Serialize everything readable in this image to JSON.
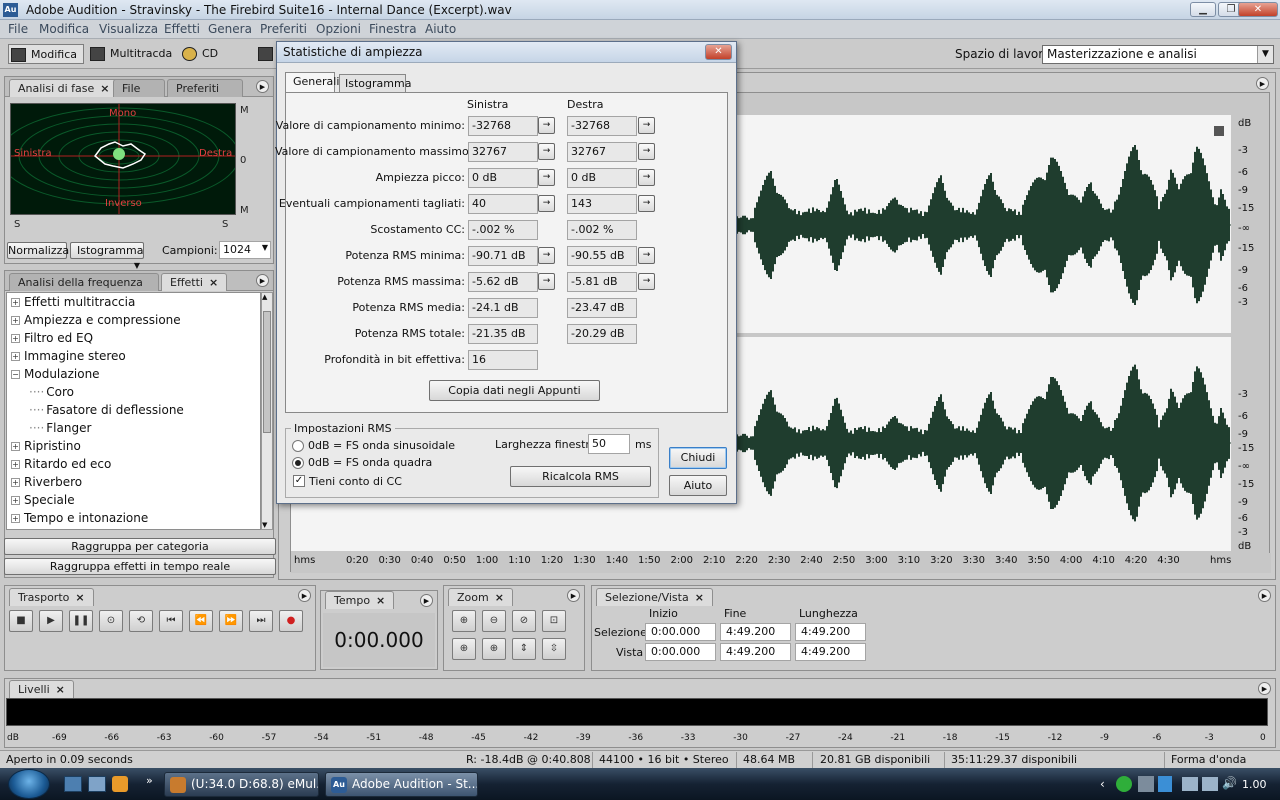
{
  "window": {
    "title": "Adobe Audition - Stravinsky - The Firebird Suite16 - Internal Dance (Excerpt).wav",
    "app_icon": "Au"
  },
  "menu": [
    "File",
    "Modifica",
    "Visualizza",
    "Effetti",
    "Genera",
    "Preferiti",
    "Opzioni",
    "Finestra",
    "Aiuto"
  ],
  "toolbar": {
    "edit": "Modifica",
    "multitrack": "Multitracda",
    "cd": "CD",
    "workspace_label": "Spazio di lavoro:",
    "workspace_value": "Masterizzazione e analisi"
  },
  "phase_panel": {
    "tabs": [
      "Analisi di fase",
      "File",
      "Preferiti"
    ],
    "mono": "Mono",
    "inverse": "Inverso",
    "left": "Sinistra",
    "right": "Destra",
    "scale_m": "M",
    "scale_0": "0",
    "scale_s": "S",
    "normalize": "Normalizza",
    "histogram": "Istogramma",
    "samples_label": "Campioni:",
    "samples_value": "1024"
  },
  "effects_panel": {
    "tabs": [
      "Analisi della frequenza",
      "Effetti"
    ],
    "items": [
      {
        "label": "Effetti multitraccia",
        "level": 0,
        "sign": "+"
      },
      {
        "label": "Ampiezza e compressione",
        "level": 0,
        "sign": "+"
      },
      {
        "label": "Filtro ed EQ",
        "level": 0,
        "sign": "+"
      },
      {
        "label": "Immagine stereo",
        "level": 0,
        "sign": "+"
      },
      {
        "label": "Modulazione",
        "level": 0,
        "sign": "−"
      },
      {
        "label": "Coro",
        "level": 1,
        "sign": ""
      },
      {
        "label": "Fasatore di deflessione",
        "level": 1,
        "sign": ""
      },
      {
        "label": "Flanger",
        "level": 1,
        "sign": ""
      },
      {
        "label": "Ripristino",
        "level": 0,
        "sign": "+"
      },
      {
        "label": "Ritardo ed eco",
        "level": 0,
        "sign": "+"
      },
      {
        "label": "Riverbero",
        "level": 0,
        "sign": "+"
      },
      {
        "label": "Speciale",
        "level": 0,
        "sign": "+"
      },
      {
        "label": "Tempo e intonazione",
        "level": 0,
        "sign": "+"
      }
    ],
    "group_by_category": "Raggruppa per categoria",
    "group_realtime": "Raggruppa effetti in tempo reale"
  },
  "dialog": {
    "title": "Statistiche di ampiezza",
    "tabs": [
      "Generali",
      "Istogramma"
    ],
    "col_left": "Sinistra",
    "col_right": "Destra",
    "rows": [
      {
        "label": "Valore di campionamento minimo:",
        "left": "-32768",
        "right": "-32768",
        "arrow": true
      },
      {
        "label": "Valore di campionamento massimo:",
        "left": "32767",
        "right": "32767",
        "arrow": true
      },
      {
        "label": "Ampiezza picco:",
        "left": "0 dB",
        "right": "0 dB",
        "arrow": true
      },
      {
        "label": "Eventuali campionamenti tagliati:",
        "left": "40",
        "right": "143",
        "arrow": true
      },
      {
        "label": "Scostamento CC:",
        "left": "-.002 %",
        "right": "-.002 %",
        "arrow": false
      },
      {
        "label": "Potenza RMS minima:",
        "left": "-90.71 dB",
        "right": "-90.55 dB",
        "arrow": true
      },
      {
        "label": "Potenza RMS massima:",
        "left": "-5.62 dB",
        "right": "-5.81 dB",
        "arrow": true
      },
      {
        "label": "Potenza RMS media:",
        "left": "-24.1 dB",
        "right": "-23.47 dB",
        "arrow": false
      },
      {
        "label": "Potenza RMS totale:",
        "left": "-21.35 dB",
        "right": "-20.29 dB",
        "arrow": false
      },
      {
        "label": "Profondità in bit effettiva:",
        "left": "16",
        "right": "",
        "arrow": false
      }
    ],
    "copy_button": "Copia dati negli Appunti",
    "rms_group": "Impostazioni RMS",
    "radio_sine": "0dB = FS onda sinusoidale",
    "radio_square": "0dB = FS onda quadra",
    "check_dc": "Tieni conto di CC",
    "window_width_label": "Larghezza finestra:",
    "window_width_value": "50",
    "window_width_unit": "ms",
    "recalc": "Ricalcola RMS",
    "close": "Chiudi",
    "help": "Aiuto"
  },
  "waveform": {
    "db_labels_top": [
      "dB",
      "-3",
      "-6",
      "-9",
      "-15",
      "-∞",
      "-15",
      "-9",
      "-6",
      "-3"
    ],
    "db_labels_bottom": [
      "-3",
      "-6",
      "-9",
      "-15",
      "-∞",
      "-15",
      "-9",
      "-6",
      "-3",
      "dB"
    ],
    "time_labels": [
      "hms",
      "0:20",
      "0:30",
      "0:40",
      "0:50",
      "1:00",
      "1:10",
      "1:20",
      "1:30",
      "1:40",
      "1:50",
      "2:00",
      "2:10",
      "2:20",
      "2:30",
      "2:40",
      "2:50",
      "3:00",
      "3:10",
      "3:20",
      "3:30",
      "3:40",
      "3:50",
      "4:00",
      "4:10",
      "4:20",
      "4:30",
      "hms"
    ]
  },
  "transport": {
    "title": "Trasporto"
  },
  "time": {
    "title": "Tempo",
    "value": "0:00.000"
  },
  "zoom": {
    "title": "Zoom"
  },
  "selection": {
    "title": "Selezione/Vista",
    "col_start": "Inizio",
    "col_end": "Fine",
    "col_length": "Lunghezza",
    "row_selection": "Selezione",
    "row_view": "Vista",
    "sel_start": "0:00.000",
    "sel_end": "4:49.200",
    "sel_len": "4:49.200",
    "view_start": "0:00.000",
    "view_end": "4:49.200",
    "view_len": "4:49.200"
  },
  "levels": {
    "title": "Livelli",
    "scale": [
      "dB",
      "-69",
      "-66",
      "-63",
      "-60",
      "-57",
      "-54",
      "-51",
      "-48",
      "-45",
      "-42",
      "-39",
      "-36",
      "-33",
      "-30",
      "-27",
      "-24",
      "-21",
      "-18",
      "-15",
      "-12",
      "-9",
      "-6",
      "-3",
      "0"
    ]
  },
  "status": {
    "opened": "Aperto in 0.09 seconds",
    "cursor": "R: -18.4dB @    0:40.808",
    "format": "44100 • 16 bit • Stereo",
    "size": "48.64 MB",
    "disk": "20.81 GB disponibili",
    "time_free": "35:11:29.37 disponibili",
    "view": "Forma d'onda"
  },
  "taskbar": {
    "emule": "(U:34.0 D:68.8) eMul...",
    "audition": "Adobe Audition - St...",
    "clock": "1.00",
    "audition_icon": "Au"
  }
}
